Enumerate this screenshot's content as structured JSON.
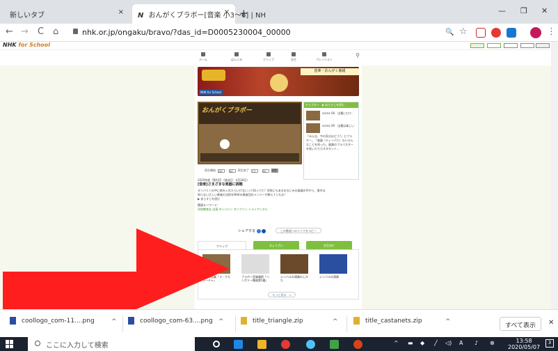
{
  "browser": {
    "tabs": [
      {
        "label": "新しいタブ"
      },
      {
        "label": "おんがくブラボー[音楽 小3〜6] | NH"
      }
    ],
    "address": "nhk.or.jp/ongaku/bravo/?das_id=D0005230004_00000",
    "new_tab_glyph": "+",
    "close_glyph": "×",
    "minimize_glyph": "—",
    "restore_glyph": "❐",
    "window_close_glyph": "✕",
    "back_glyph": "←",
    "forward_glyph": "→",
    "reload_glyph": "C",
    "home_glyph": "⌂",
    "zoom_glyph": "🔍",
    "star_glyph": "☆",
    "menu_glyph": "⋮"
  },
  "nhk": {
    "logo_prefix": "NHK ",
    "logo_brand": "for School",
    "categories": [
      "ホーム",
      "ばんぐみ",
      "クリップ",
      "先生",
      "プレイリスト"
    ]
  },
  "banner": {
    "badge": "NHK for School",
    "label": "音楽・おんがく番組"
  },
  "video": {
    "title": "おんがくブラボー"
  },
  "chapter": {
    "header": "チャプター　▶ あらすじを読む",
    "items": [
      "scene 08　出番にむけ..",
      "scene 09　出番は楽しい"
    ],
    "summary": "「みんな、今の気分はどう?」とブラボー。「楽器（ティンパニ）のいろんなことを知った。楽器のブルバスターを吹いたりカスタネット..."
  },
  "range": {
    "start_label": "再生開始",
    "start_min": "00",
    "start_sec": "00",
    "end_label": "再生終了",
    "end_min": "12",
    "end_sec": "00",
    "btn": "決定"
  },
  "info": {
    "date": "2020年度［第4回］（放送日：4月28日）",
    "title": "[音楽]さまざまな楽器に挑戦",
    "body": "タンバリンの中に紙を入れたらいけないって知ってた？学校にもあるおなじみの楽器の中から、意外な知らない正しい奏者の法則をNHKの奏者団のメンバーが教えてくれる！",
    "readmore": "▶ あらすじを読む",
    "kw_label": "関連キーワード：",
    "keywords": "学校教育全 出演 タンバリン タンブリン トライアングル"
  },
  "share": {
    "label": "シェアする",
    "copy": "この動画へのリンクをコピー"
  },
  "section_tabs": [
    "クリップ",
    "きょうざい",
    "先生向け"
  ],
  "clips": [
    {
      "title": "今日の音楽「ラ・クカラーチャ」"
    },
    {
      "title": "ブラボー音楽美術「ハンガリー舞曲第5番」"
    },
    {
      "title": "シンバルの演奏のしかた"
    },
    {
      "title": "シンバルの演奏"
    }
  ],
  "more": "もっと見る　∨",
  "downloads": [
    {
      "name": "coollogo_com-11....png"
    },
    {
      "name": "coollogo_com-63....png"
    },
    {
      "name": "title_triangle.zip"
    },
    {
      "name": "title_castanets.zip"
    }
  ],
  "show_all": "すべて表示",
  "taskbar": {
    "search_placeholder": "ここに入力して検索",
    "time": "13:58",
    "date": "2020/05/07",
    "notif": "3",
    "ime": "A"
  },
  "colors": {
    "arrow": "#ff1e1e",
    "green": "#7fbf3f",
    "page_bg": "#f6f8ed"
  }
}
